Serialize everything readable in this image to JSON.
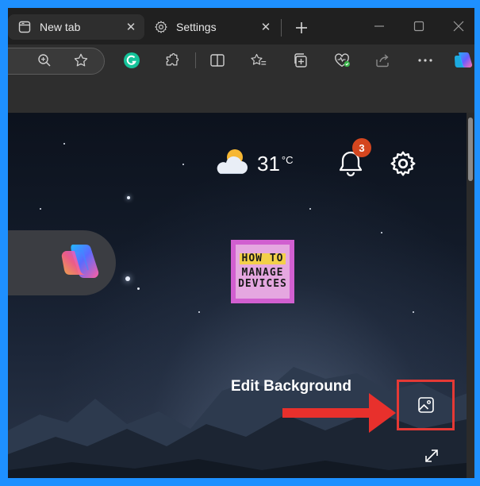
{
  "tabs": [
    {
      "label": "New tab",
      "icon": "new-tab-page-icon",
      "active": true
    },
    {
      "label": "Settings",
      "icon": "gear-icon",
      "active": false
    }
  ],
  "toolbar": {
    "icons": [
      "zoom-icon",
      "favorite-star-icon",
      "grammarly-icon",
      "extensions-icon",
      "split-screen-icon",
      "favorites-list-icon",
      "collections-icon",
      "browser-essentials-icon",
      "share-icon",
      "more-icon",
      "copilot-icon"
    ]
  },
  "weather": {
    "temperature": "31",
    "unit": "°C",
    "icon": "partly-cloudy-icon"
  },
  "notifications": {
    "count": "3"
  },
  "logo": {
    "line1": "HOW TO",
    "line2": "MANAGE",
    "line3": "DEVICES"
  },
  "annotation": {
    "label": "Edit Background",
    "color": "#e8302c"
  },
  "colors": {
    "frame": "#1e90ff",
    "chrome": "#202020",
    "badge": "#d4461f"
  }
}
